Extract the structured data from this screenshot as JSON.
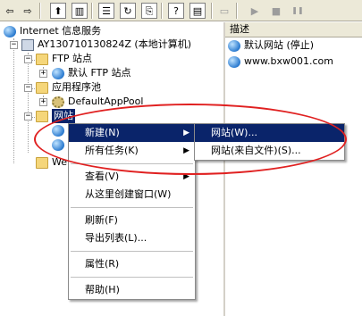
{
  "toolbar": {
    "buttons": [
      {
        "name": "back-button",
        "glyph": "⇦"
      },
      {
        "name": "forward-button",
        "glyph": "⇨"
      },
      {
        "name": "up-folder-button",
        "glyph": "⬆"
      },
      {
        "name": "show-hide-tree-button",
        "glyph": "▥"
      },
      {
        "name": "properties-button",
        "glyph": "☰"
      },
      {
        "name": "refresh-button",
        "glyph": "↻"
      },
      {
        "name": "export-list-button",
        "glyph": "⎘"
      },
      {
        "name": "help-button",
        "glyph": "?"
      },
      {
        "name": "show-hide-action-pane-button",
        "glyph": "▤"
      },
      {
        "name": "connect-computer-button",
        "glyph": "▭"
      },
      {
        "name": "start-button",
        "glyph": "▶"
      },
      {
        "name": "stop-button",
        "glyph": "■"
      },
      {
        "name": "pause-button",
        "glyph": "❚❚"
      }
    ]
  },
  "tree": {
    "root": "Internet 信息服务",
    "computer": "AY130710130824Z (本地计算机)",
    "ftp_folder": "FTP 站点",
    "ftp_default": "默认 FTP 站点",
    "app_pools": "应用程序池",
    "default_app_pool": "DefaultAppPool",
    "websites": "网站",
    "web_ext": "We"
  },
  "list": {
    "column": "描述",
    "items": [
      "默认网站 (停止)",
      "www.bxw001.com"
    ]
  },
  "context_menu": {
    "items": {
      "new": "新建(N)",
      "all_tasks": "所有任务(K)",
      "view": "查看(V)",
      "new_window": "从这里创建窗口(W)",
      "refresh": "刷新(F)",
      "export": "导出列表(L)...",
      "properties": "属性(R)",
      "help": "帮助(H)"
    }
  },
  "submenu": {
    "website": "网站(W)...",
    "website_from_file": "网站(来自文件)(S)..."
  },
  "colors": {
    "highlight": "#0a246a",
    "annotation": "#e02020",
    "chrome": "#ece9d8"
  }
}
